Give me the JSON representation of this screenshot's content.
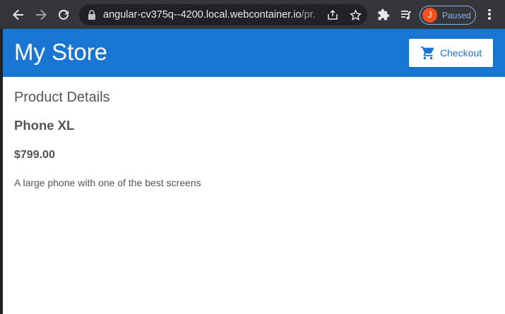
{
  "browser": {
    "url_main": "angular-cv375q--4200.local.webcontainer.io",
    "url_rest": "/pr...",
    "profile_initial": "J",
    "profile_status": "Paused",
    "icons": [
      "back-arrow-icon",
      "forward-arrow-icon",
      "reload-icon",
      "lock-icon",
      "share-icon",
      "star-icon",
      "extensions-icon",
      "media-queue-icon",
      "menu-icon"
    ]
  },
  "store": {
    "title": "My Store",
    "checkout_label": "Checkout",
    "accent_color": "#1976d2"
  },
  "product": {
    "section_heading": "Product Details",
    "name": "Phone XL",
    "price": "$799.00",
    "description": "A large phone with one of the best screens"
  }
}
